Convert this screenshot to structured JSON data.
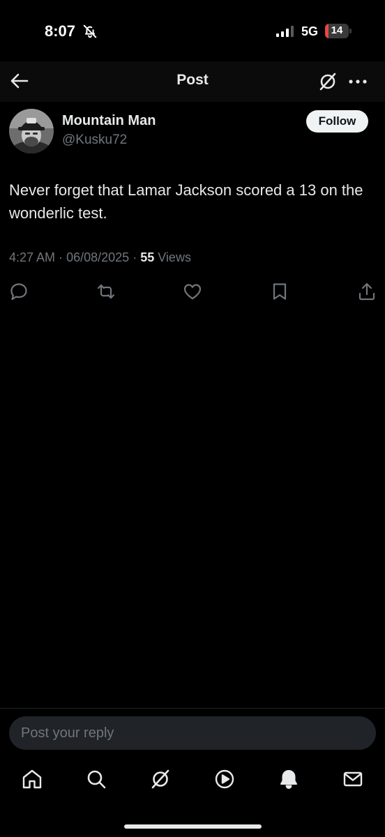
{
  "status_bar": {
    "time": "8:07",
    "network": "5G",
    "battery_level": "14",
    "battery_fraction": 0.14,
    "battery_color": "#e5483e",
    "icons": [
      "bell-muted-icon",
      "cellular-signal-icon",
      "battery-icon"
    ]
  },
  "header": {
    "title": "Post",
    "icons": [
      "back-arrow-icon",
      "grok-icon",
      "more-options-icon"
    ]
  },
  "author": {
    "name": "Mountain Man",
    "handle": "@Kusku72",
    "follow_label": "Follow"
  },
  "post": {
    "text": "Never forget that Lamar Jackson scored a 13 on the wonderlic test.",
    "time": "4:27 AM",
    "date": "06/08/2025",
    "separator": "·",
    "views_count": "55",
    "views_label": "Views"
  },
  "actions": [
    "reply-icon",
    "repost-icon",
    "like-icon",
    "bookmark-icon",
    "share-icon"
  ],
  "reply": {
    "placeholder": "Post your reply"
  },
  "tab_bar": [
    "home-icon",
    "search-icon",
    "grok-icon",
    "video-icon",
    "notifications-icon",
    "messages-icon"
  ],
  "colors": {
    "background": "#000000",
    "text_primary": "#e7e9ea",
    "text_secondary": "#71767b",
    "follow_button_bg": "#eff3f4"
  }
}
